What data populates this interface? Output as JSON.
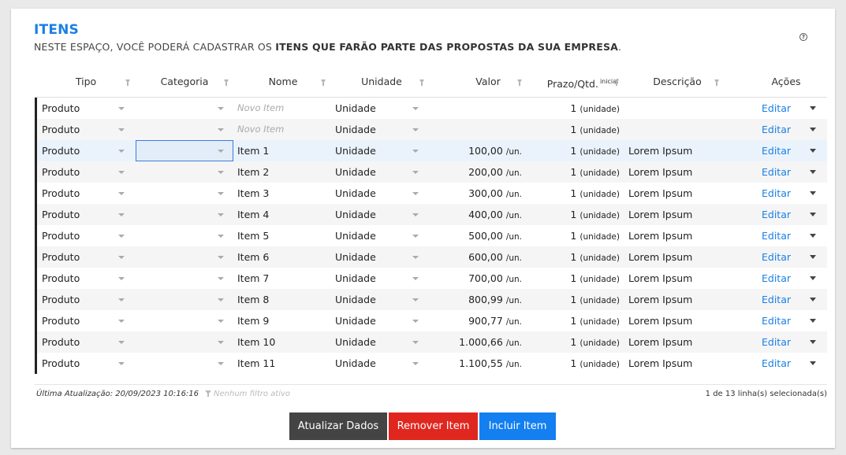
{
  "header": {
    "title": "ITENS",
    "subtitle_prefix": "NESTE ESPAÇO, VOCÊ PODERÁ CADASTRAR OS ",
    "subtitle_bold": "ITENS QUE FARÃO PARTE DAS PROPOSTAS DA SUA EMPRESA",
    "subtitle_suffix": ".",
    "help_label": "?"
  },
  "columns": {
    "tipo": "Tipo",
    "categoria": "Categoria",
    "nome": "Nome",
    "unidade": "Unidade",
    "valor": "Valor",
    "prazo": "Prazo/Qtd.",
    "prazo_sup": "inicial",
    "descricao": "Descrição",
    "acoes": "Ações"
  },
  "rows": [
    {
      "tipo": "Produto",
      "nome": "Novo Item",
      "placeholder": true,
      "unidade": "Unidade",
      "valor": "",
      "valor_un": "",
      "qtd": "1",
      "qtd_un": "(unidade)",
      "descricao": "",
      "acao": "Editar"
    },
    {
      "tipo": "Produto",
      "nome": "Novo Item",
      "placeholder": true,
      "unidade": "Unidade",
      "valor": "",
      "valor_un": "",
      "qtd": "1",
      "qtd_un": "(unidade)",
      "descricao": "",
      "acao": "Editar"
    },
    {
      "tipo": "Produto",
      "nome": "Item 1",
      "unidade": "Unidade",
      "valor": "100,00",
      "valor_un": "/un.",
      "qtd": "1",
      "qtd_un": "(unidade)",
      "descricao": "Lorem Ipsum",
      "acao": "Editar",
      "selected": true
    },
    {
      "tipo": "Produto",
      "nome": "Item 2",
      "unidade": "Unidade",
      "valor": "200,00",
      "valor_un": "/un.",
      "qtd": "1",
      "qtd_un": "(unidade)",
      "descricao": "Lorem Ipsum",
      "acao": "Editar"
    },
    {
      "tipo": "Produto",
      "nome": "Item 3",
      "unidade": "Unidade",
      "valor": "300,00",
      "valor_un": "/un.",
      "qtd": "1",
      "qtd_un": "(unidade)",
      "descricao": "Lorem Ipsum",
      "acao": "Editar"
    },
    {
      "tipo": "Produto",
      "nome": "Item 4",
      "unidade": "Unidade",
      "valor": "400,00",
      "valor_un": "/un.",
      "qtd": "1",
      "qtd_un": "(unidade)",
      "descricao": "Lorem Ipsum",
      "acao": "Editar"
    },
    {
      "tipo": "Produto",
      "nome": "Item 5",
      "unidade": "Unidade",
      "valor": "500,00",
      "valor_un": "/un.",
      "qtd": "1",
      "qtd_un": "(unidade)",
      "descricao": "Lorem Ipsum",
      "acao": "Editar"
    },
    {
      "tipo": "Produto",
      "nome": "Item 6",
      "unidade": "Unidade",
      "valor": "600,00",
      "valor_un": "/un.",
      "qtd": "1",
      "qtd_un": "(unidade)",
      "descricao": "Lorem Ipsum",
      "acao": "Editar"
    },
    {
      "tipo": "Produto",
      "nome": "Item 7",
      "unidade": "Unidade",
      "valor": "700,00",
      "valor_un": "/un.",
      "qtd": "1",
      "qtd_un": "(unidade)",
      "descricao": "Lorem Ipsum",
      "acao": "Editar"
    },
    {
      "tipo": "Produto",
      "nome": "Item 8",
      "unidade": "Unidade",
      "valor": "800,99",
      "valor_un": "/un.",
      "qtd": "1",
      "qtd_un": "(unidade)",
      "descricao": "Lorem Ipsum",
      "acao": "Editar"
    },
    {
      "tipo": "Produto",
      "nome": "Item 9",
      "unidade": "Unidade",
      "valor": "900,77",
      "valor_un": "/un.",
      "qtd": "1",
      "qtd_un": "(unidade)",
      "descricao": "Lorem Ipsum",
      "acao": "Editar"
    },
    {
      "tipo": "Produto",
      "nome": "Item 10",
      "unidade": "Unidade",
      "valor": "1.000,66",
      "valor_un": "/un.",
      "qtd": "1",
      "qtd_un": "(unidade)",
      "descricao": "Lorem Ipsum",
      "acao": "Editar"
    },
    {
      "tipo": "Produto",
      "nome": "Item 11",
      "unidade": "Unidade",
      "valor": "1.100,55",
      "valor_un": "/un.",
      "qtd": "1",
      "qtd_un": "(unidade)",
      "descricao": "Lorem Ipsum",
      "acao": "Editar"
    }
  ],
  "footer": {
    "last_update": "Última Atualização: 20/09/2023 10:16:16",
    "filter_status": "Nenhum filtro ativo",
    "selection": "1 de 13 linha(s) selecionada(s)"
  },
  "buttons": {
    "update": "Atualizar Dados",
    "remove": "Remover Item",
    "add": "Incluir Item"
  },
  "colors": {
    "accent": "#1a7fe6",
    "update_button": "#444444",
    "remove_button": "#e0271f",
    "add_button": "#137ff0"
  }
}
